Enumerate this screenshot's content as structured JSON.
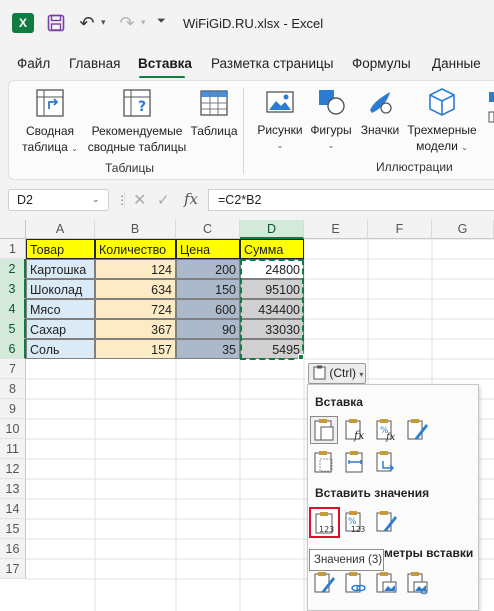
{
  "app": {
    "window_title": "WiFiGiD.RU.xlsx  -  Excel",
    "brand_color": "#107c41",
    "logo_letter": "X"
  },
  "menu": {
    "tabs": [
      "Файл",
      "Главная",
      "Вставка",
      "Разметка страницы",
      "Формулы",
      "Данные"
    ],
    "active_tab": "Вставка"
  },
  "ribbon": {
    "tables_group": {
      "label": "Таблицы",
      "buttons": [
        {
          "line1": "Сводная",
          "line2": "таблица",
          "icon": "pivot-table-icon"
        },
        {
          "line1": "Рекомендуемые",
          "line2": "сводные таблицы",
          "icon": "recommended-pivot-icon"
        },
        {
          "line1": "Таблица",
          "line2": "",
          "icon": "table-icon"
        }
      ]
    },
    "illustrations_group": {
      "label": "Иллюстрации",
      "buttons": [
        {
          "line1": "Рисунки",
          "icon": "pictures-icon"
        },
        {
          "line1": "Фигуры",
          "icon": "shapes-icon"
        },
        {
          "line1": "Значки",
          "icon": "icons-icon"
        },
        {
          "line1": "Трехмерные",
          "line2": "модели",
          "icon": "3d-models-icon"
        }
      ]
    }
  },
  "formula_bar": {
    "name_box": "D2",
    "fx_label": "fx",
    "formula": "=C2*B2"
  },
  "sheet": {
    "columns": [
      "A",
      "B",
      "C",
      "D",
      "E",
      "F",
      "G"
    ],
    "selected_column": "D",
    "rows": [
      "1",
      "2",
      "3",
      "4",
      "5",
      "6",
      "7",
      "8",
      "9",
      "10",
      "11",
      "12",
      "13",
      "14",
      "15",
      "16",
      "17"
    ],
    "header": [
      "Товар",
      "Количество",
      "Цена",
      "Сумма"
    ],
    "data": [
      [
        "Картошка",
        "124",
        "200",
        "24800"
      ],
      [
        "Шоколад",
        "634",
        "150",
        "95100"
      ],
      [
        "Мясо",
        "724",
        "600",
        "434400"
      ],
      [
        "Сахар",
        "367",
        "90",
        "33030"
      ],
      [
        "Соль",
        "157",
        "35",
        "5495"
      ]
    ]
  },
  "paste_options": {
    "button_label": "(Ctrl)",
    "section_paste": "Вставка",
    "section_values": "Вставить значения",
    "section_other": "метры вставки",
    "tooltip": "Значения (3)",
    "value_icon_text": "123",
    "number_icon_text": "%"
  }
}
